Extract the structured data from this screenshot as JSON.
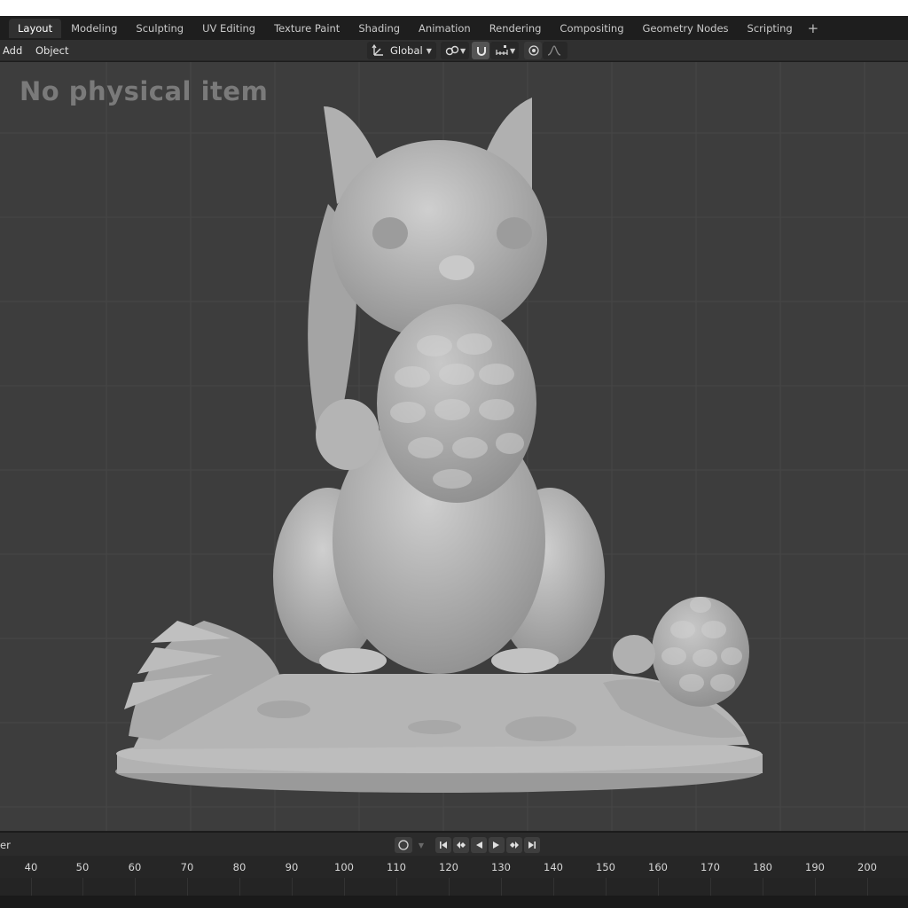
{
  "workspace_tabs": [
    {
      "label": "Layout",
      "active": true
    },
    {
      "label": "Modeling",
      "active": false
    },
    {
      "label": "Sculpting",
      "active": false
    },
    {
      "label": "UV Editing",
      "active": false
    },
    {
      "label": "Texture Paint",
      "active": false
    },
    {
      "label": "Shading",
      "active": false
    },
    {
      "label": "Animation",
      "active": false
    },
    {
      "label": "Rendering",
      "active": false
    },
    {
      "label": "Compositing",
      "active": false
    },
    {
      "label": "Geometry Nodes",
      "active": false
    },
    {
      "label": "Scripting",
      "active": false
    }
  ],
  "workspace_add_label": "+",
  "header": {
    "menu_add": "Add",
    "menu_object": "Object",
    "orientation": "Global",
    "icons": [
      "transform-orientation-icon",
      "pivot-link-icon",
      "snap-magnet-icon",
      "snap-increment-icon",
      "proportional-edit-icon",
      "falloff-curve-icon"
    ]
  },
  "viewport": {
    "watermark": "No physical item",
    "background_color": "#3d3d3d",
    "model_color": "#b8b8b8"
  },
  "timeline": {
    "label": "er",
    "frame_ticks": [
      "40",
      "50",
      "60",
      "70",
      "80",
      "90",
      "100",
      "110",
      "120",
      "130",
      "140",
      "150",
      "160",
      "170",
      "180",
      "190",
      "200"
    ],
    "controls": [
      "keyframe-record-icon",
      "jump-start-icon",
      "prev-keyframe-icon",
      "play-reverse-icon",
      "play-icon",
      "next-keyframe-icon",
      "jump-end-icon"
    ]
  },
  "colors": {
    "active_tab": "#303030",
    "header": "#303030",
    "workspace_bar": "#1e1e1e"
  }
}
